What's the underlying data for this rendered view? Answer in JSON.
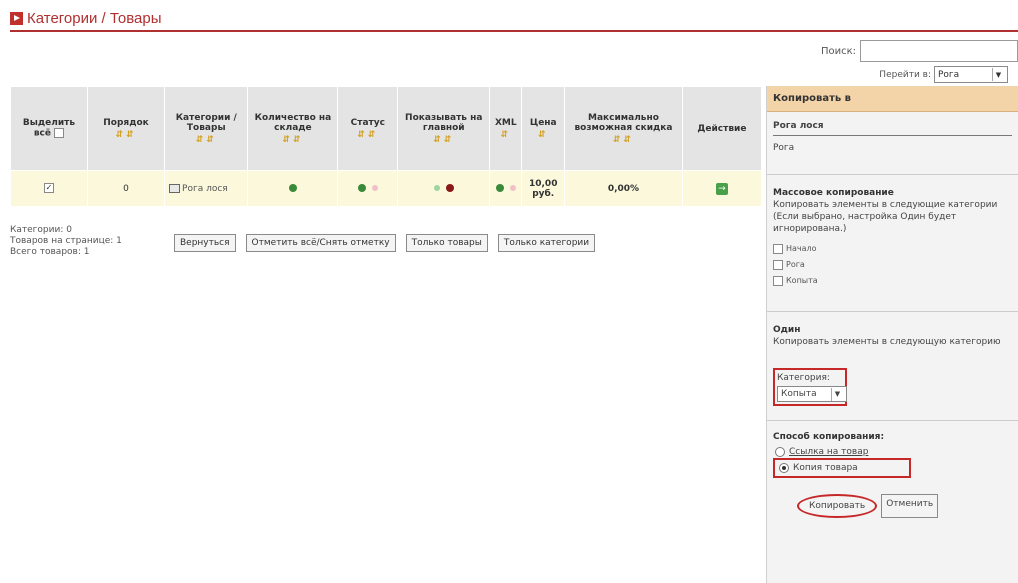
{
  "page": {
    "title": "Категории / Товары"
  },
  "search": {
    "label": "Поиск:",
    "value": ""
  },
  "jump": {
    "label": "Перейти в:",
    "value": "Рога"
  },
  "table": {
    "headers": {
      "select_all": "Выделить всё",
      "order": "Порядок",
      "categories": "Категории / Товары",
      "stock": "Количество на складе",
      "status": "Статус",
      "show_main": "Показывать на главной",
      "xml": "XML",
      "price": "Цена",
      "max_discount": "Максимально возможная скидка",
      "action": "Действие"
    },
    "rows": [
      {
        "order": "0",
        "name": "Рога лося",
        "price": "10,00 руб.",
        "discount": "0,00%"
      }
    ]
  },
  "stats": {
    "categories": "Категории: 0",
    "per_page": "Товаров на странице: 1",
    "total": "Всего товаров: 1"
  },
  "buttons": {
    "back": "Вернуться",
    "toggle": "Отметить всё/Снять отметку",
    "only_products": "Только товары",
    "only_categories": "Только категории"
  },
  "panel": {
    "header": "Копировать в",
    "item_title": "Рога лося",
    "item_subtitle": "Рога",
    "mass_title": "Массовое копирование",
    "mass_desc": "Копировать элементы в следующие категории (Если выбрано, настройка Один будет игнорирована.)",
    "mass_options": [
      "Начало",
      "Рога",
      "Копыта"
    ],
    "one_title": "Один",
    "one_desc": "Копировать элементы в следующую категорию",
    "category_label": "Категория:",
    "category_value": "Копыта",
    "method_title": "Способ копирования:",
    "method_link": "Ссылка на товар",
    "method_copy": "Копия товара",
    "copy_button": "Копировать",
    "cancel_button": "Отменить"
  }
}
